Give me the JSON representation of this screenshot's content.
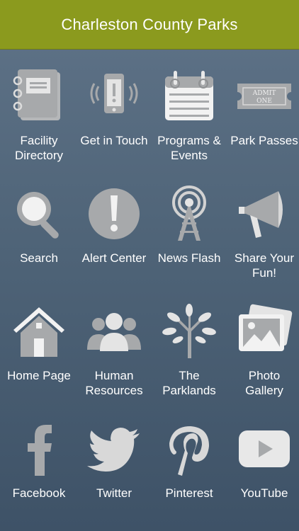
{
  "header": {
    "title": "Charleston County Parks"
  },
  "colors": {
    "header_bg": "#8b9a1e",
    "icon_fill": "#a7a9ab",
    "icon_light": "#e4e4e4",
    "text": "#ffffff"
  },
  "tiles": [
    {
      "label": "Facility\nDirectory",
      "icon": "notebook-icon"
    },
    {
      "label": "Get in Touch",
      "icon": "phone-alert-icon"
    },
    {
      "label": "Programs &\nEvents",
      "icon": "calendar-icon"
    },
    {
      "label": "Park Passes",
      "icon": "ticket-icon",
      "ticket_text": "ADMIT\nONE"
    },
    {
      "label": "Search",
      "icon": "magnifier-icon"
    },
    {
      "label": "Alert Center",
      "icon": "exclamation-icon"
    },
    {
      "label": "News Flash",
      "icon": "broadcast-tower-icon"
    },
    {
      "label": "Share Your\nFun!",
      "icon": "megaphone-icon"
    },
    {
      "label": "Home Page",
      "icon": "house-icon"
    },
    {
      "label": "Human\nResources",
      "icon": "people-icon"
    },
    {
      "label": "The\nParklands",
      "icon": "tree-icon"
    },
    {
      "label": "Photo\nGallery",
      "icon": "photo-icon"
    },
    {
      "label": "Facebook",
      "icon": "facebook-icon"
    },
    {
      "label": "Twitter",
      "icon": "twitter-icon"
    },
    {
      "label": "Pinterest",
      "icon": "pinterest-icon"
    },
    {
      "label": "YouTube",
      "icon": "youtube-icon"
    }
  ]
}
